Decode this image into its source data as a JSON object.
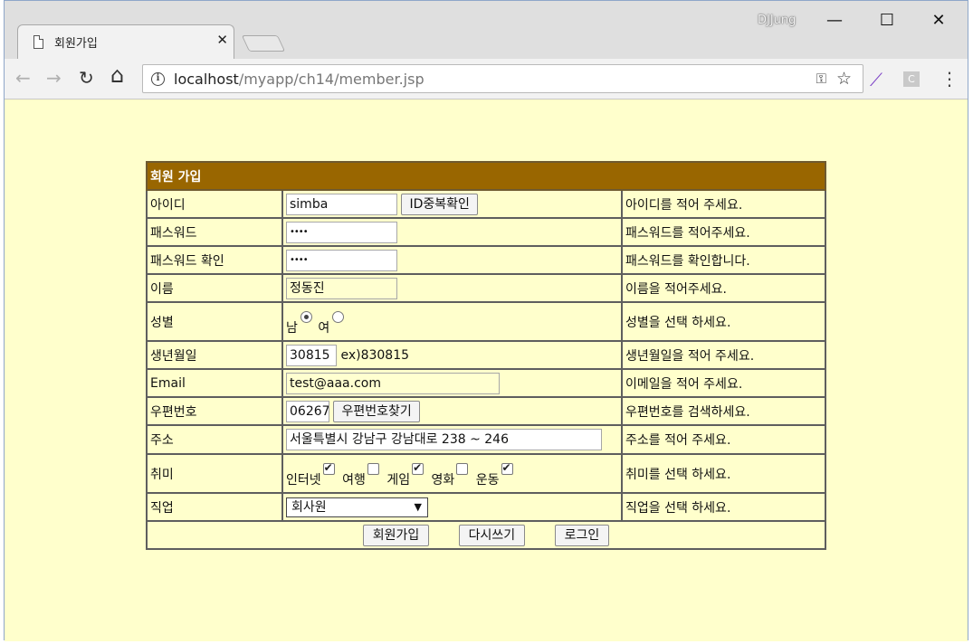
{
  "browser": {
    "tab_title": "회원가입",
    "tab_close": "✕",
    "user": "DJJung",
    "minimize": "—",
    "maximize": "☐",
    "close": "✕",
    "back": "←",
    "forward": "→",
    "reload": "↻",
    "home": "⌂",
    "url_host": "localhost",
    "url_path": "/myapp/ch14/member.jsp",
    "key": "🔑",
    "star": "☆",
    "ext_feather": "/",
    "ext_c": "C",
    "menu": "⋮"
  },
  "form": {
    "title": "회원 가입",
    "rows": {
      "id": {
        "label": "아이디",
        "value": "simba",
        "button": "ID중복확인",
        "hint": "아이디를 적어 주세요."
      },
      "pw": {
        "label": "패스워드",
        "value": "••••",
        "hint": "패스워드를 적어주세요."
      },
      "pw_confirm": {
        "label": "패스워드 확인",
        "value": "••••",
        "hint": "패스워드를 확인합니다."
      },
      "name": {
        "label": "이름",
        "value": "정동진",
        "hint": "이름을 적어주세요."
      },
      "gender": {
        "label": "성별",
        "male": "남",
        "female": "여",
        "selected": "남",
        "hint": "성별을 선택 하세요."
      },
      "birthday": {
        "label": "생년월일",
        "value": "30815",
        "example": "ex)830815",
        "hint": "생년월일을 적어 주세요."
      },
      "email": {
        "label": "Email",
        "value": "test@aaa.com",
        "hint": "이메일을 적어 주세요."
      },
      "zipcode": {
        "label": "우편번호",
        "value": "06267",
        "button": "우편번호찾기",
        "hint": "우편번호를 검색하세요."
      },
      "address": {
        "label": "주소",
        "value": "서울특별시 강남구 강남대로 238 ~ 246",
        "hint": "주소를 적어 주세요."
      },
      "hobby": {
        "label": "취미",
        "items": [
          {
            "name": "인터넷",
            "checked": true
          },
          {
            "name": "여행",
            "checked": false
          },
          {
            "name": "게임",
            "checked": true
          },
          {
            "name": "영화",
            "checked": false
          },
          {
            "name": "운동",
            "checked": true
          }
        ],
        "hint": "취미를 선택 하세요."
      },
      "job": {
        "label": "직업",
        "value": "회사원",
        "hint": "직업을 선택 하세요."
      }
    },
    "buttons": {
      "submit": "회원가입",
      "reset": "다시쓰기",
      "login": "로그인"
    }
  }
}
